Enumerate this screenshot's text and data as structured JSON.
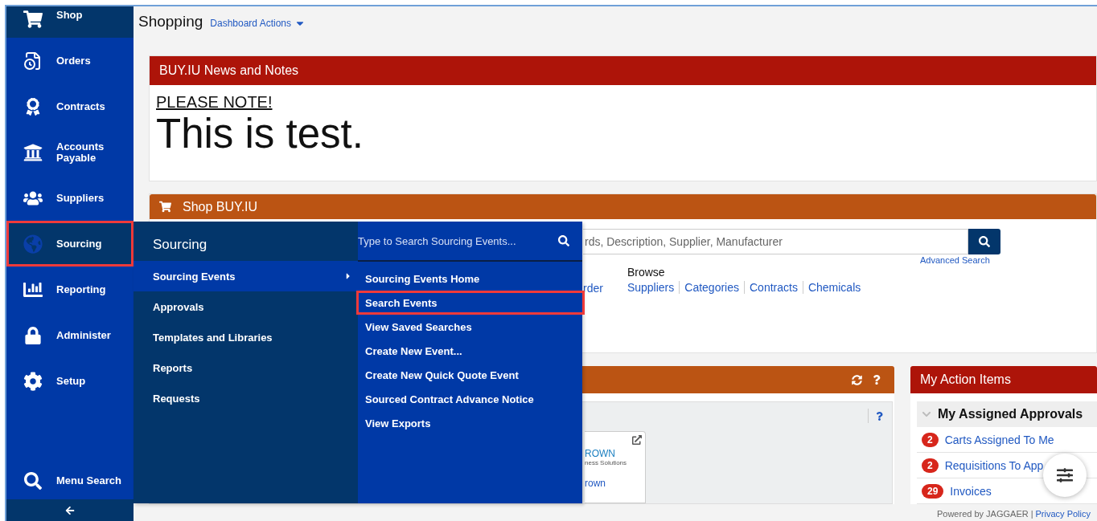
{
  "sidebar": {
    "items": [
      {
        "label": "Shop",
        "selected": true,
        "annotated": false
      },
      {
        "label": "Orders",
        "selected": false,
        "annotated": false
      },
      {
        "label": "Contracts",
        "selected": false,
        "annotated": false
      },
      {
        "label": "Accounts Payable",
        "selected": false,
        "annotated": false
      },
      {
        "label": "Suppliers",
        "selected": false,
        "annotated": false
      },
      {
        "label": "Sourcing",
        "selected": true,
        "annotated": true
      },
      {
        "label": "Reporting",
        "selected": false,
        "annotated": false
      },
      {
        "label": "Administer",
        "selected": false,
        "annotated": false
      },
      {
        "label": "Setup",
        "selected": false,
        "annotated": false
      }
    ],
    "menu_search": "Menu Search"
  },
  "page": {
    "title": "Shopping",
    "actions_label": "Dashboard Actions"
  },
  "news": {
    "title": "BUY.IU News and Notes",
    "heading": "PLEASE NOTE!",
    "body": "This is test."
  },
  "shop": {
    "title": "Shop BUY.IU",
    "search_placeholder": "rds, Description, Supplier, Manufacturer",
    "advanced_search": "Advanced Search",
    "order_link": "rder",
    "browse_label": "Browse",
    "browse_links": [
      "Suppliers",
      "Categories",
      "Contracts",
      "Chemicals"
    ]
  },
  "widget": {
    "card": {
      "logo": "ROWN",
      "logo_tagline": "ness Solutions",
      "link": "rown"
    }
  },
  "action_items": {
    "title": "My Action Items",
    "section": {
      "title": "My Assigned Approvals",
      "expanded": true
    },
    "items": [
      {
        "count": "2",
        "label": "Carts Assigned To Me"
      },
      {
        "count": "2",
        "label": "Requisitions To App"
      },
      {
        "count": "29",
        "label": "Invoices"
      }
    ]
  },
  "footer": {
    "powered_by": "Powered by JAGGAER",
    "separator": "|",
    "link": "Privacy Policy"
  },
  "flyout": {
    "title": "Sourcing",
    "items": [
      {
        "label": "Sourcing Events",
        "selected": true,
        "submenu": true
      },
      {
        "label": "Approvals",
        "selected": false,
        "submenu": false
      },
      {
        "label": "Templates and Libraries",
        "selected": false,
        "submenu": false
      },
      {
        "label": "Reports",
        "selected": false,
        "submenu": false
      },
      {
        "label": "Requests",
        "selected": false,
        "submenu": false
      }
    ],
    "submenu": {
      "search_placeholder": "Type to Search Sourcing Events...",
      "items": [
        {
          "label": "Sourcing Events Home",
          "annotated": false
        },
        {
          "label": "Search Events",
          "annotated": true
        },
        {
          "label": "View Saved Searches",
          "annotated": false
        },
        {
          "label": "Create New Event...",
          "annotated": false
        },
        {
          "label": "Create New Quick Quote Event",
          "annotated": false
        },
        {
          "label": "Sourced Contract Advance Notice",
          "annotated": false
        },
        {
          "label": "View Exports",
          "annotated": false
        }
      ]
    }
  }
}
